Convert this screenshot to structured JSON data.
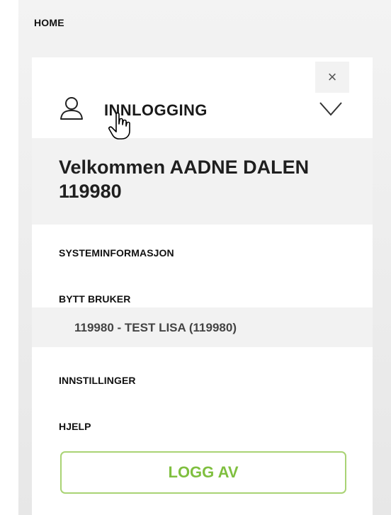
{
  "header": {
    "home_label": "HOME"
  },
  "panel": {
    "close_symbol": "×",
    "login_title": "INNLOGGING",
    "welcome_line1": "Velkommen AADNE DALEN",
    "welcome_line2": "119980",
    "menu": {
      "system_info": "SYSTEMINFORMASJON",
      "switch_user": "BYTT BRUKER",
      "switch_user_option": "119980 - TEST LISA (119980)",
      "settings": "INNSTILLINGER",
      "help": "HJELP"
    },
    "logout_label": "LOGG AV"
  },
  "icons": {
    "user": "user-icon",
    "chevron": "chevron-down-icon",
    "close": "close-icon",
    "cursor": "hand-cursor-icon"
  },
  "colors": {
    "accent_green": "#7fbf3f",
    "button_border": "#a9d374",
    "panel_bg": "#ffffff",
    "highlight_bg": "#f2f2f2",
    "page_bg": "#eeeeee"
  }
}
